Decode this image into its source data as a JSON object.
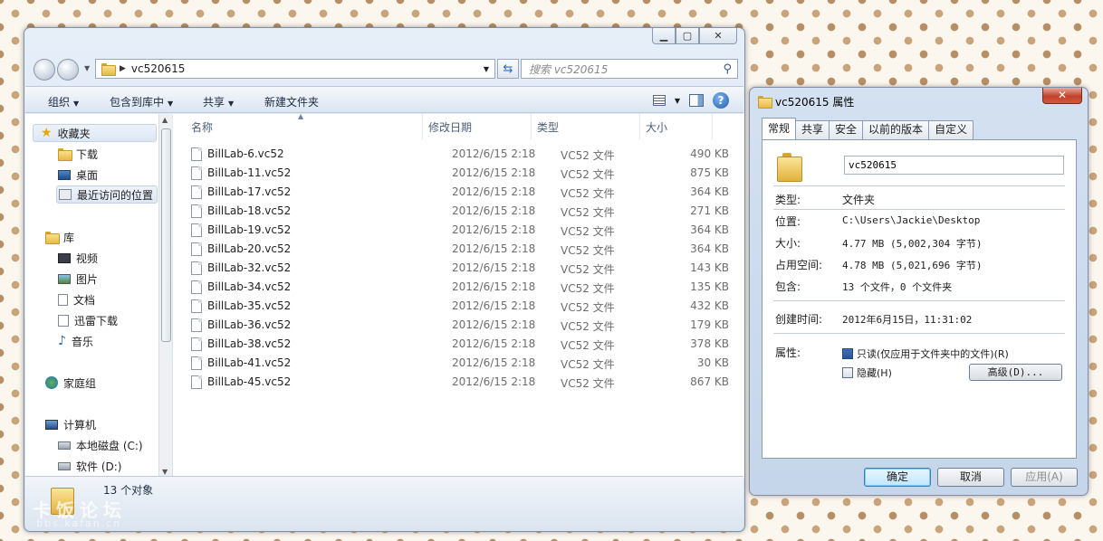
{
  "explorer": {
    "address": {
      "path": "vc520615"
    },
    "search": {
      "placeholder": "搜索 vc520615"
    },
    "toolbar": {
      "organize": "组织",
      "include_in_library": "包含到库中",
      "share": "共享",
      "new_folder": "新建文件夹"
    },
    "nav": {
      "favorites": "收藏夹",
      "downloads": "下载",
      "desktop": "桌面",
      "recent": "最近访问的位置",
      "libraries": "库",
      "videos": "视频",
      "pictures": "图片",
      "documents": "文档",
      "thunder": "迅雷下载",
      "music": "音乐",
      "homegroup": "家庭组",
      "computer": "计算机",
      "local_disk_c": "本地磁盘 (C:)",
      "software_d": "软件 (D:)"
    },
    "columns": {
      "name": "名称",
      "date": "修改日期",
      "type": "类型",
      "size": "大小"
    },
    "files": [
      {
        "name": "BillLab-6.vc52",
        "date": "2012/6/15 2:18",
        "type": "VC52 文件",
        "size": "490 KB"
      },
      {
        "name": "BillLab-11.vc52",
        "date": "2012/6/15 2:18",
        "type": "VC52 文件",
        "size": "875 KB"
      },
      {
        "name": "BillLab-17.vc52",
        "date": "2012/6/15 2:18",
        "type": "VC52 文件",
        "size": "364 KB"
      },
      {
        "name": "BillLab-18.vc52",
        "date": "2012/6/15 2:18",
        "type": "VC52 文件",
        "size": "271 KB"
      },
      {
        "name": "BillLab-19.vc52",
        "date": "2012/6/15 2:18",
        "type": "VC52 文件",
        "size": "364 KB"
      },
      {
        "name": "BillLab-20.vc52",
        "date": "2012/6/15 2:18",
        "type": "VC52 文件",
        "size": "364 KB"
      },
      {
        "name": "BillLab-32.vc52",
        "date": "2012/6/15 2:18",
        "type": "VC52 文件",
        "size": "143 KB"
      },
      {
        "name": "BillLab-34.vc52",
        "date": "2012/6/15 2:18",
        "type": "VC52 文件",
        "size": "135 KB"
      },
      {
        "name": "BillLab-35.vc52",
        "date": "2012/6/15 2:18",
        "type": "VC52 文件",
        "size": "432 KB"
      },
      {
        "name": "BillLab-36.vc52",
        "date": "2012/6/15 2:18",
        "type": "VC52 文件",
        "size": "179 KB"
      },
      {
        "name": "BillLab-38.vc52",
        "date": "2012/6/15 2:18",
        "type": "VC52 文件",
        "size": "378 KB"
      },
      {
        "name": "BillLab-41.vc52",
        "date": "2012/6/15 2:18",
        "type": "VC52 文件",
        "size": "30 KB"
      },
      {
        "name": "BillLab-45.vc52",
        "date": "2012/6/15 2:18",
        "type": "VC52 文件",
        "size": "867 KB"
      }
    ],
    "status": {
      "count": "13 个对象"
    }
  },
  "properties": {
    "title": "vc520615 属性",
    "tabs": [
      "常规",
      "共享",
      "安全",
      "以前的版本",
      "自定义"
    ],
    "folder_name": "vc520615",
    "type_label": "类型:",
    "type_value": "文件夹",
    "location_label": "位置:",
    "location_value": "C:\\Users\\Jackie\\Desktop",
    "size_label": "大小:",
    "size_value": "4.77 MB (5,002,304 字节)",
    "disk_label": "占用空间:",
    "disk_value": "4.78 MB (5,021,696 字节)",
    "contains_label": "包含:",
    "contains_value": "13 个文件，0 个文件夹",
    "created_label": "创建时间:",
    "created_value": "2012年6月15日，11:31:02",
    "attributes_label": "属性:",
    "readonly_label": "只读(仅应用于文件夹中的文件)(R)",
    "readonly_checked": true,
    "hidden_label": "隐藏(H)",
    "hidden_checked": false,
    "advanced_button": "高级(D)...",
    "ok_button": "确定",
    "cancel_button": "取消",
    "apply_button": "应用(A)"
  },
  "watermark": {
    "text": "卡饭论坛",
    "sub": "bbs.kafan.cn"
  },
  "colors": {
    "accent": "#3c7fb1",
    "folder": "#e7b946",
    "close": "#c2412a"
  }
}
